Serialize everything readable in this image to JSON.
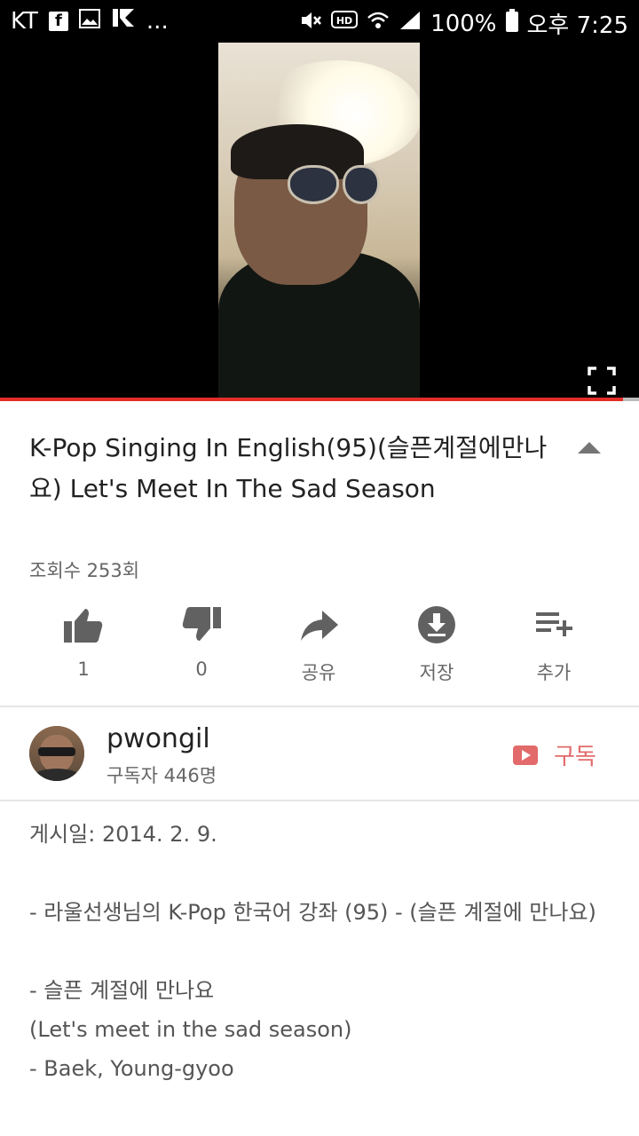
{
  "status_bar": {
    "carrier": "KT",
    "notif_more": "...",
    "battery": "100%",
    "time": "오후 7:25",
    "icons_left": [
      "facebook-icon",
      "gallery-icon",
      "app-icon"
    ],
    "icons_right": [
      "mute-icon",
      "hd-icon",
      "wifi-icon",
      "signal-icon",
      "battery-icon"
    ]
  },
  "video": {
    "progress_fraction": 0.975,
    "progress_color": "#e52d27",
    "fullscreen_icon": "fullscreen-icon"
  },
  "title": "K-Pop Singing In English(95)(슬픈계절에만나요) Let's Meet In The Sad Season",
  "views": "조회수 253회",
  "actions": [
    {
      "name": "like",
      "label": "1",
      "icon": "thumbs-up-icon"
    },
    {
      "name": "dislike",
      "label": "0",
      "icon": "thumbs-down-icon"
    },
    {
      "name": "share",
      "label": "공유",
      "icon": "share-icon"
    },
    {
      "name": "save",
      "label": "저장",
      "icon": "download-icon"
    },
    {
      "name": "add",
      "label": "추가",
      "icon": "playlist-add-icon"
    }
  ],
  "channel": {
    "name": "pwongil",
    "subscribers": "구독자 446명",
    "subscribe_label": "구독",
    "accent_color": "#e26a6a"
  },
  "description": {
    "posted": "게시일: 2014. 2. 9.",
    "line1": "- 라울선생님의 K-Pop 한국어 강좌 (95) - (슬픈 계절에 만나요)",
    "line2": "- 슬픈 계절에 만나요",
    "line3": "(Let's meet in the sad season)",
    "line4": "- Baek, Young-gyoo"
  }
}
